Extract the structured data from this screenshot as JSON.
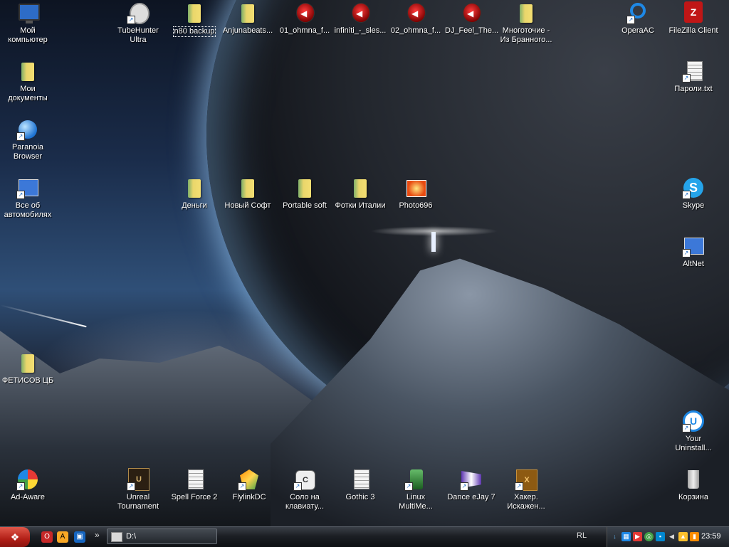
{
  "desktop": {
    "icons": {
      "my_computer": "Мой компьютер",
      "tubehunter": "TubeHunter Ultra",
      "n80": "n80 backup",
      "anjuna": "Anjunabeats...",
      "ohmna1": "01_ohmna_f...",
      "infiniti": "infiniti_-_sles...",
      "ohmna2": "02_ohmna_f...",
      "djfeel": "DJ_Feel_The...",
      "mnogo": "Многоточие - Из Бранного...",
      "opera": "OperaAC",
      "filezilla": "FileZilla Client",
      "mydocs": "Мои документы",
      "passwords": "Пароли.txt",
      "paranoia": "Paranoia Browser",
      "cars": "Все об автомобилях",
      "money": "Деньги",
      "newsoft": "Новый Софт",
      "portable": "Portable soft",
      "italy": "Фотки Италии",
      "photo": "Photo696",
      "skype": "Skype",
      "altnet": "AltNet",
      "fetisov": "ФЕТИСОВ ЦБ",
      "uninstaller": "Your Uninstall...",
      "adaware": "Ad-Aware",
      "unreal": "Unreal Tournament",
      "spellforce": "Spell Force 2",
      "flylink": "FlylinkDC",
      "solo": "Соло на клавиату...",
      "gothic": "Gothic 3",
      "linuxmm": "Linux MultiMe...",
      "dance": "Dance eJay 7",
      "hacker": "Хакер. Искажен...",
      "recycle": "Корзина"
    }
  },
  "taskbar": {
    "task_title": "D:\\",
    "chevron": "»",
    "language": "RL",
    "clock": "23:59"
  }
}
